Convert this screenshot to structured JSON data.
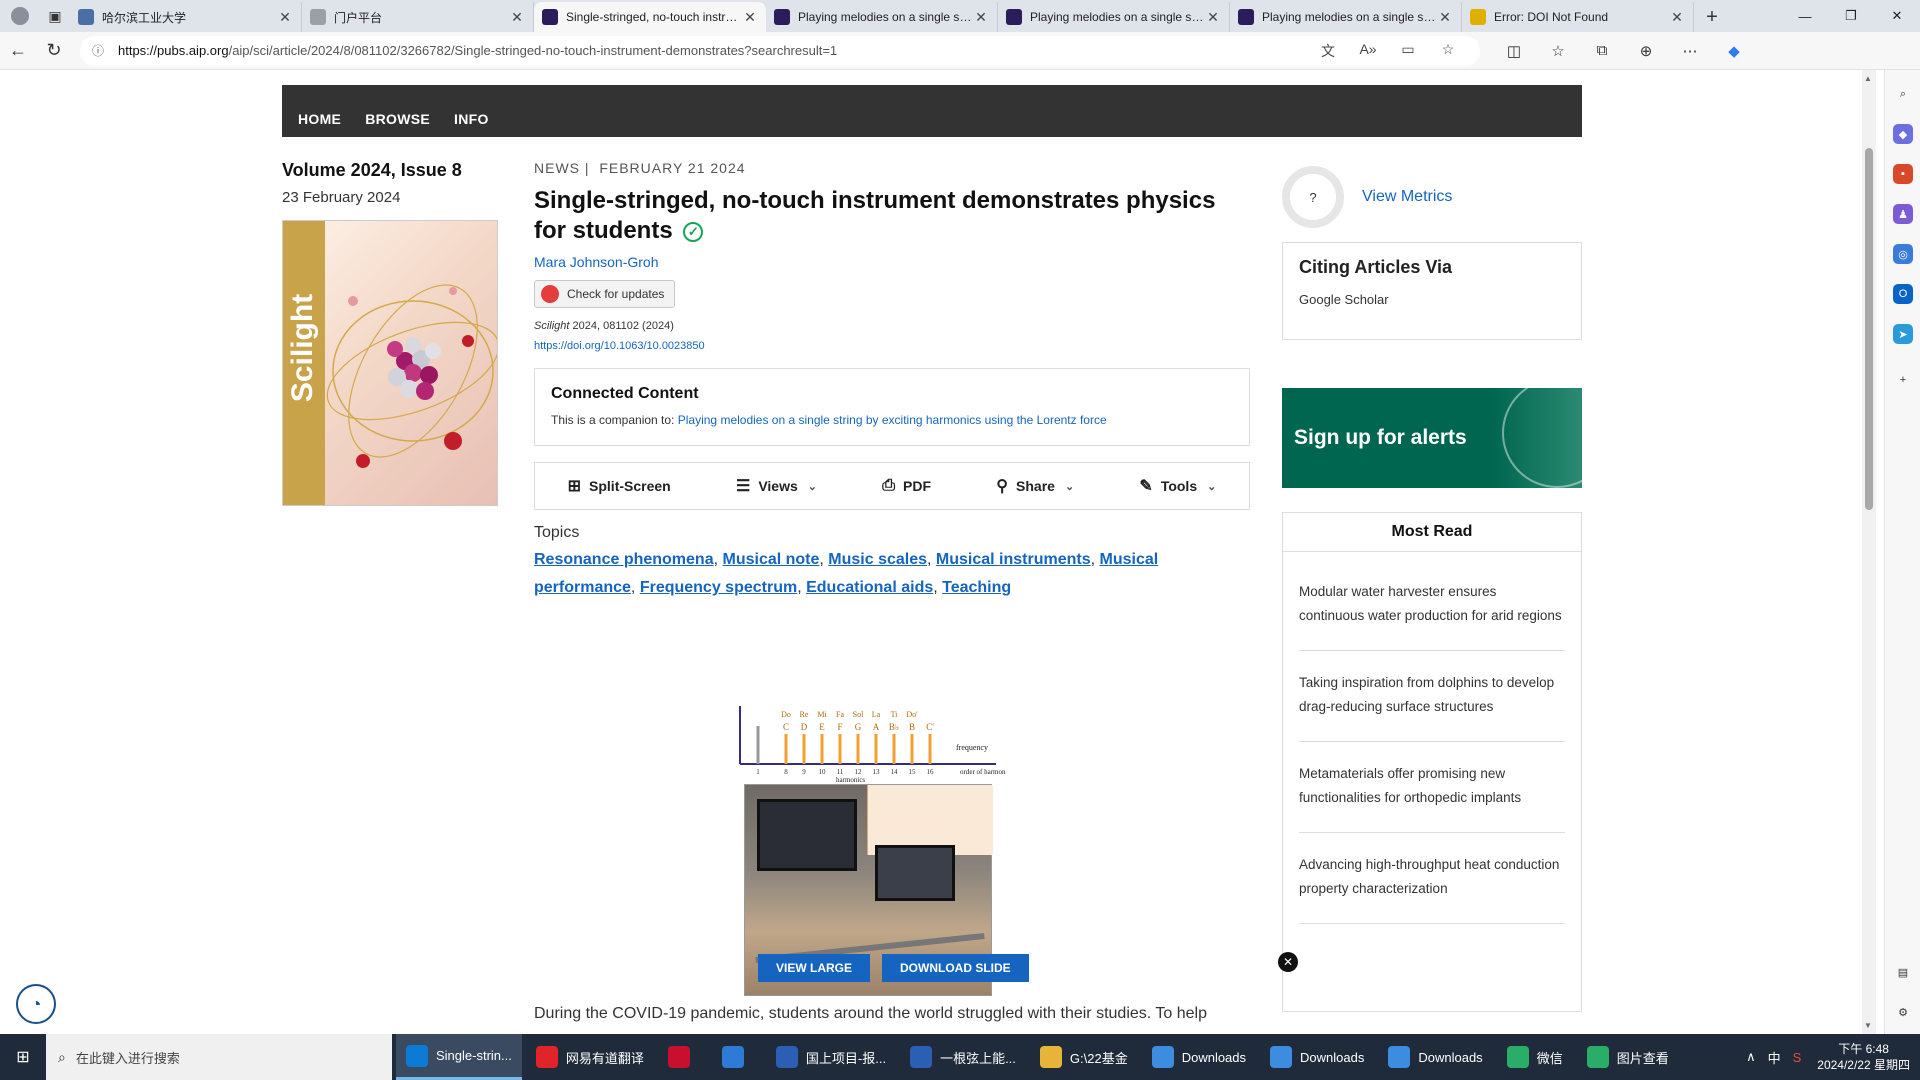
{
  "browser": {
    "tabs": [
      {
        "title": "哈尔滨工业大学",
        "fav_color": "#4a6fa5",
        "active": false
      },
      {
        "title": "门户平台",
        "fav_color": "#9aa0a6",
        "active": false
      },
      {
        "title": "Single-stringed, no-touch instru...",
        "fav_color": "#2b1d5c",
        "active": true
      },
      {
        "title": "Playing melodies on a single str...",
        "fav_color": "#2b1d5c",
        "active": false
      },
      {
        "title": "Playing melodies on a single str...",
        "fav_color": "#2b1d5c",
        "active": false
      },
      {
        "title": "Playing melodies on a single str...",
        "fav_color": "#2b1d5c",
        "active": false
      },
      {
        "title": "Error: DOI Not Found",
        "fav_color": "#e0b000",
        "active": false
      }
    ],
    "url_host": "https://pubs.aip.org",
    "url_path": "/aip/sci/article/2024/8/081102/3266782/Single-stringed-no-touch-instrument-demonstrates?searchresult=1"
  },
  "site": {
    "nav": [
      "HOME",
      "BROWSE",
      "INFO"
    ]
  },
  "issue": {
    "volume": "Volume 2024, Issue 8",
    "date": "23 February 2024",
    "cover_brand": "Scilight"
  },
  "article": {
    "category": "NEWS",
    "date": "FEBRUARY 21 2024",
    "title": "Single-stringed, no-touch instrument demonstrates physics for students",
    "author": "Mara Johnson-Groh",
    "updates_label": "Check for updates",
    "citation_journal": "Scilight",
    "citation_rest": " 2024, 081102 (2024)",
    "doi": "https://doi.org/10.1063/10.0023850",
    "connected_title": "Connected Content",
    "connected_prefix": "This is a companion to:",
    "connected_link": "Playing melodies on a single string by exciting harmonics using the Lorentz force",
    "tools": [
      {
        "label": "Split-Screen",
        "icon": "split-screen-icon",
        "chevron": false
      },
      {
        "label": "Views",
        "icon": "views-icon",
        "chevron": true
      },
      {
        "label": "PDF",
        "icon": "pdf-icon",
        "chevron": false
      },
      {
        "label": "Share",
        "icon": "share-icon",
        "chevron": true
      },
      {
        "label": "Tools",
        "icon": "tools-icon",
        "chevron": true
      }
    ],
    "topics_heading": "Topics",
    "topics": [
      "Resonance phenomena",
      "Musical note",
      "Music scales",
      "Musical instruments",
      "Musical performance",
      "Frequency spectrum",
      "Educational aids",
      "Teaching"
    ],
    "figure_buttons": {
      "view_large": "VIEW LARGE",
      "download_slide": "DOWNLOAD SLIDE"
    },
    "body_start": "During the COVID-19 pandemic, students around the world struggled with their studies. To help"
  },
  "figure": {
    "notes": [
      "Do",
      "Re",
      "Mi",
      "Fa",
      "Sol",
      "La",
      "Ti",
      "Do'"
    ],
    "letters": [
      "C",
      "D",
      "E",
      "F",
      "G",
      "A",
      "B♭",
      "B",
      "C'"
    ],
    "orders": [
      "1",
      "8",
      "9",
      "10",
      "11",
      "12",
      "13",
      "14",
      "15",
      "16"
    ],
    "axis_labels": [
      "frequency",
      "order of harmonics (n)",
      "harmonics"
    ]
  },
  "sidebar": {
    "metrics_symbol": "?",
    "metrics_label": "View Metrics",
    "citing_title": "Citing Articles Via",
    "citing_link": "Google Scholar",
    "signup": "Sign up for alerts",
    "most_read_title": "Most Read",
    "most_read": [
      "Modular water harvester ensures continuous water production for arid regions",
      "Taking inspiration from dolphins to develop drag-reducing surface structures",
      "Metamaterials offer promising new functionalities for orthopedic implants",
      "Advancing high-throughput heat conduction property characterization"
    ]
  },
  "taskbar": {
    "search_placeholder": "在此键入进行搜索",
    "apps": [
      {
        "label": "Single-strin...",
        "color": "#0c7bd6",
        "active": true
      },
      {
        "label": "网易有道翻译",
        "color": "#e0242a",
        "active": false
      },
      {
        "label": "",
        "color": "#c8102e",
        "active": false
      },
      {
        "label": "",
        "color": "#2d7bd6",
        "active": false
      },
      {
        "label": "国上项目-报...",
        "color": "#2b5fb4",
        "active": false
      },
      {
        "label": "一根弦上能...",
        "color": "#2b5fb4",
        "active": false
      },
      {
        "label": "G:\\22基金",
        "color": "#e8b339",
        "active": false
      },
      {
        "label": "Downloads",
        "color": "#3c8de0",
        "active": false
      },
      {
        "label": "Downloads",
        "color": "#3c8de0",
        "active": false
      },
      {
        "label": "Downloads",
        "color": "#3c8de0",
        "active": false
      },
      {
        "label": "微信",
        "color": "#2aae67",
        "active": false
      },
      {
        "label": "图片查看",
        "color": "#2aae67",
        "active": false
      }
    ],
    "ime": "中",
    "time": "下午 6:48",
    "date": "2024/2/22 星期四"
  }
}
